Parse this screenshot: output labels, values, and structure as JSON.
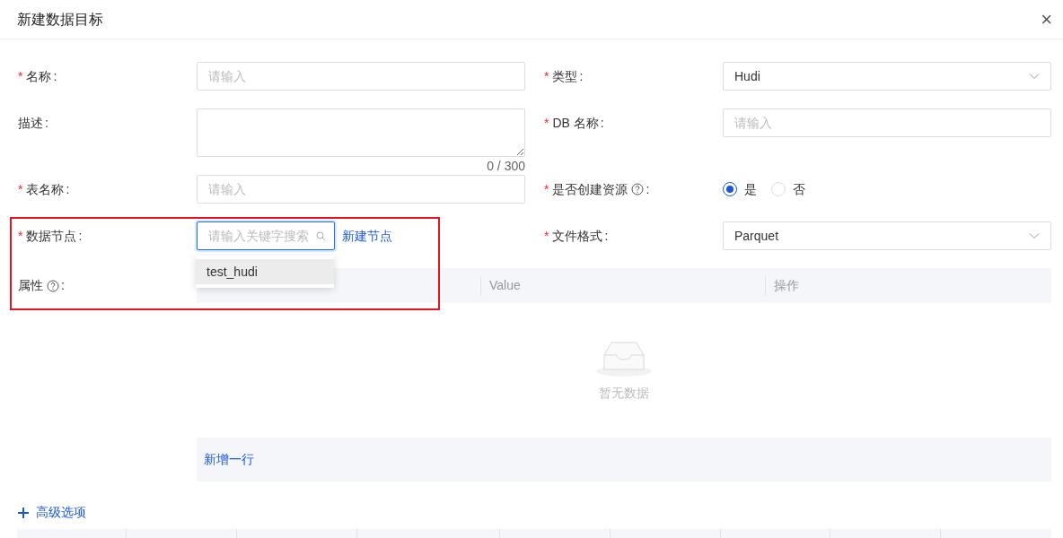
{
  "dialog": {
    "title": "新建数据目标",
    "close": "×"
  },
  "left_fields": [
    {
      "kind": "input",
      "required_mark": "*",
      "label": "名称",
      "colon": ":",
      "placeholder": "请输入"
    },
    {
      "kind": "textarea",
      "label": "描述",
      "colon": ":",
      "counter": "0 / 300"
    },
    {
      "kind": "input",
      "required_mark": "*",
      "label": "表名称",
      "colon": ":",
      "placeholder": "请输入"
    },
    {
      "kind": "search",
      "required_mark": "*",
      "label": "数据节点",
      "colon": ":",
      "placeholder": "请输入关键字搜索",
      "link": "新建节点",
      "focused": true
    }
  ],
  "right_fields": [
    {
      "kind": "select",
      "required_mark": "*",
      "label": "类型",
      "colon": ":",
      "value": "Hudi"
    },
    {
      "kind": "input",
      "required_mark": "*",
      "label": "DB 名称",
      "colon": ":",
      "placeholder": "请输入"
    },
    {
      "kind": "radio",
      "required_mark": "*",
      "label": "是否创建资源",
      "help": true,
      "colon": ":",
      "options": [
        {
          "label": "是",
          "selected": true
        },
        {
          "label": "否",
          "selected": false
        }
      ]
    },
    {
      "kind": "select",
      "required_mark": "*",
      "label": "文件格式",
      "colon": ":",
      "value": "Parquet"
    }
  ],
  "dropdown": {
    "options": [
      {
        "label": "test_hudi",
        "selected": true
      }
    ]
  },
  "properties": {
    "label": "属性",
    "help": true,
    "colon": ":",
    "columns": [
      "Value",
      "操作"
    ],
    "empty_text": "暂无数据",
    "add_row": "新增一行"
  },
  "advanced": {
    "label": "高级选项"
  }
}
